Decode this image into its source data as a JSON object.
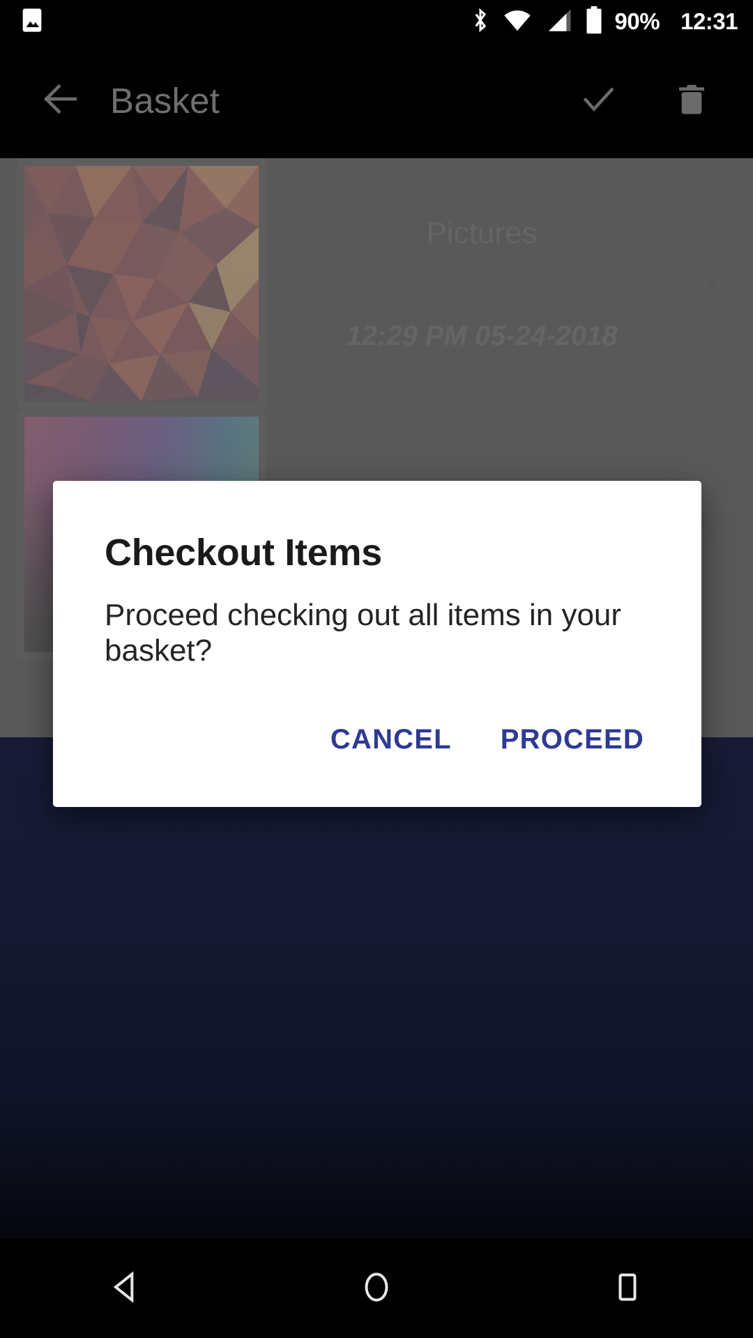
{
  "status_bar": {
    "notification_icon": "image-icon",
    "bluetooth_icon": "bluetooth-icon",
    "wifi_icon": "wifi-icon",
    "signal_icon": "cellular-signal-icon",
    "battery_icon": "battery-icon",
    "battery_text": "90%",
    "clock": "12:31"
  },
  "app_bar": {
    "back_icon": "arrow-left-icon",
    "title": "Basket",
    "confirm_icon": "check-icon",
    "delete_icon": "trash-icon"
  },
  "list": {
    "items": [
      {
        "title": "Pictures",
        "subtitle": "12:29 PM 05-24-2018",
        "chevron_icon": "chevron-right-icon",
        "thumbnail": "low-poly-red-artwork"
      },
      {
        "title": "",
        "subtitle": "",
        "chevron_icon": "chevron-right-icon",
        "thumbnail": "purple-gradient-artwork"
      }
    ]
  },
  "dialog": {
    "title": "Checkout Items",
    "message": "Proceed checking out all items in your basket?",
    "cancel_label": "CANCEL",
    "proceed_label": "PROCEED",
    "accent_color": "#2e3a94"
  },
  "nav_bar": {
    "back_icon": "nav-back-triangle-icon",
    "home_icon": "nav-home-circle-icon",
    "recents_icon": "nav-recents-square-icon"
  },
  "colors": {
    "status_bar_bg": "#000000",
    "app_bar_bg": "#000000",
    "scrim": "rgba(128,128,128,0.62)",
    "navy_body": "#141830",
    "dialog_bg": "#ffffff"
  }
}
